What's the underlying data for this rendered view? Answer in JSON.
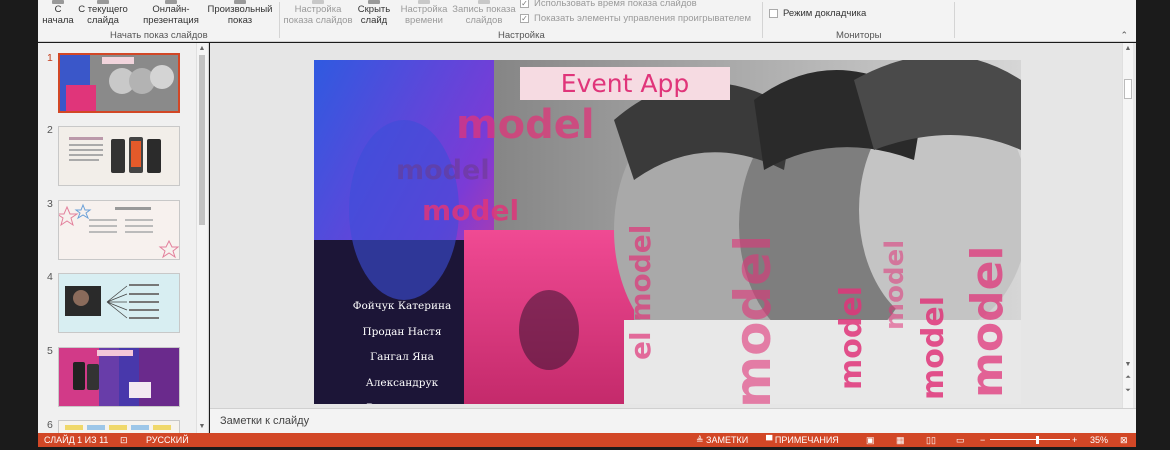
{
  "ribbon": {
    "from_start": "С\nначала",
    "from_current": "С текущего\nслайда",
    "online": "Онлайн-\nпрезентация",
    "custom": "Произвольный\nпоказ",
    "group_start": "Начать показ слайдов",
    "setup_show": "Настройка\nпоказа слайдов",
    "hide_slide": "Скрыть\nслайд",
    "rehearse": "Настройка\nвремени",
    "record": "Запись показа\nслайдов",
    "use_timings": "Использовать время показа слайдов",
    "show_controls": "Показать элементы управления проигрывателем",
    "group_setup": "Настройка",
    "presenter_view": "Режим докладчика",
    "group_monitors": "Мониторы"
  },
  "thumbnails": [
    "1",
    "2",
    "3",
    "4",
    "5",
    "6"
  ],
  "slide": {
    "title": "Event App",
    "model_words": [
      "model",
      "model",
      "model"
    ],
    "names": [
      "Фойчук Катерина",
      "Продан Настя",
      "Гангал Яна",
      "Александрук Володислава"
    ],
    "vertical_words": [
      "el model",
      "model",
      "model",
      "model",
      "model",
      "model"
    ]
  },
  "notes": {
    "placeholder": "Заметки к слайду"
  },
  "status": {
    "slide_of": "СЛАЙД 1 ИЗ 11",
    "language": "РУССКИЙ",
    "notes": "ЗАМЕТКИ",
    "comments": "ПРИМЕЧАНИЯ",
    "zoom": "35%"
  },
  "colors": {
    "accent": "#d24726",
    "pink": "#e0357a"
  }
}
